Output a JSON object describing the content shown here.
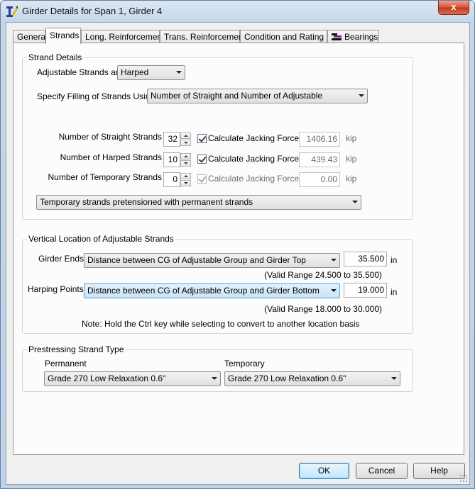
{
  "window": {
    "title": "Girder Details for Span 1, Girder 4",
    "close_label": "x"
  },
  "tabs": [
    {
      "label": "General"
    },
    {
      "label": "Strands"
    },
    {
      "label": "Long. Reinforcement"
    },
    {
      "label": "Trans. Reinforcement"
    },
    {
      "label": "Condition and Rating"
    },
    {
      "label": "Bearings"
    }
  ],
  "strand_details": {
    "title": "Strand Details",
    "adjustable_label": "Adjustable Strands are",
    "adjustable_value": "Harped",
    "filling_label": "Specify Filling of Strands Using",
    "filling_value": "Number of Straight and Number of Adjustable",
    "rows": [
      {
        "label": "Number of Straight Strands",
        "count": "32",
        "check_label": "Calculate Jacking Force",
        "force": "1406.16",
        "unit": "kip"
      },
      {
        "label": "Number of Harped Strands",
        "count": "10",
        "check_label": "Calculate Jacking Force",
        "force": "439.43",
        "unit": "kip"
      },
      {
        "label": "Number of Temporary Strands",
        "count": "0",
        "check_label": "Calculate Jacking Force",
        "force": "0.00",
        "unit": "kip"
      }
    ],
    "temporary_option": "Temporary strands pretensioned with permanent strands"
  },
  "vertical_location": {
    "title": "Vertical Location of Adjustable Strands",
    "girder_ends_label": "Girder Ends:",
    "girder_ends_value": "Distance between CG of Adjustable Group and Girder Top",
    "girder_ends_input": "35.500",
    "girder_ends_unit": "in",
    "girder_ends_range": "(Valid Range 24.500 to 35.500)",
    "harping_label": "Harping Points:",
    "harping_value": "Distance between CG of Adjustable Group and Girder Bottom",
    "harping_input": "19.000",
    "harping_unit": "in",
    "harping_range": "(Valid Range 18.000 to 30.000)",
    "note": "Note: Hold the Ctrl key while selecting to convert to another location basis"
  },
  "strand_type": {
    "title": "Prestressing Strand Type",
    "permanent_label": "Permanent",
    "permanent_value": "Grade 270 Low Relaxation 0.6\"",
    "temporary_label": "Temporary",
    "temporary_value": "Grade 270 Low Relaxation 0.6\""
  },
  "buttons": {
    "ok": "OK",
    "cancel": "Cancel",
    "help": "Help"
  }
}
